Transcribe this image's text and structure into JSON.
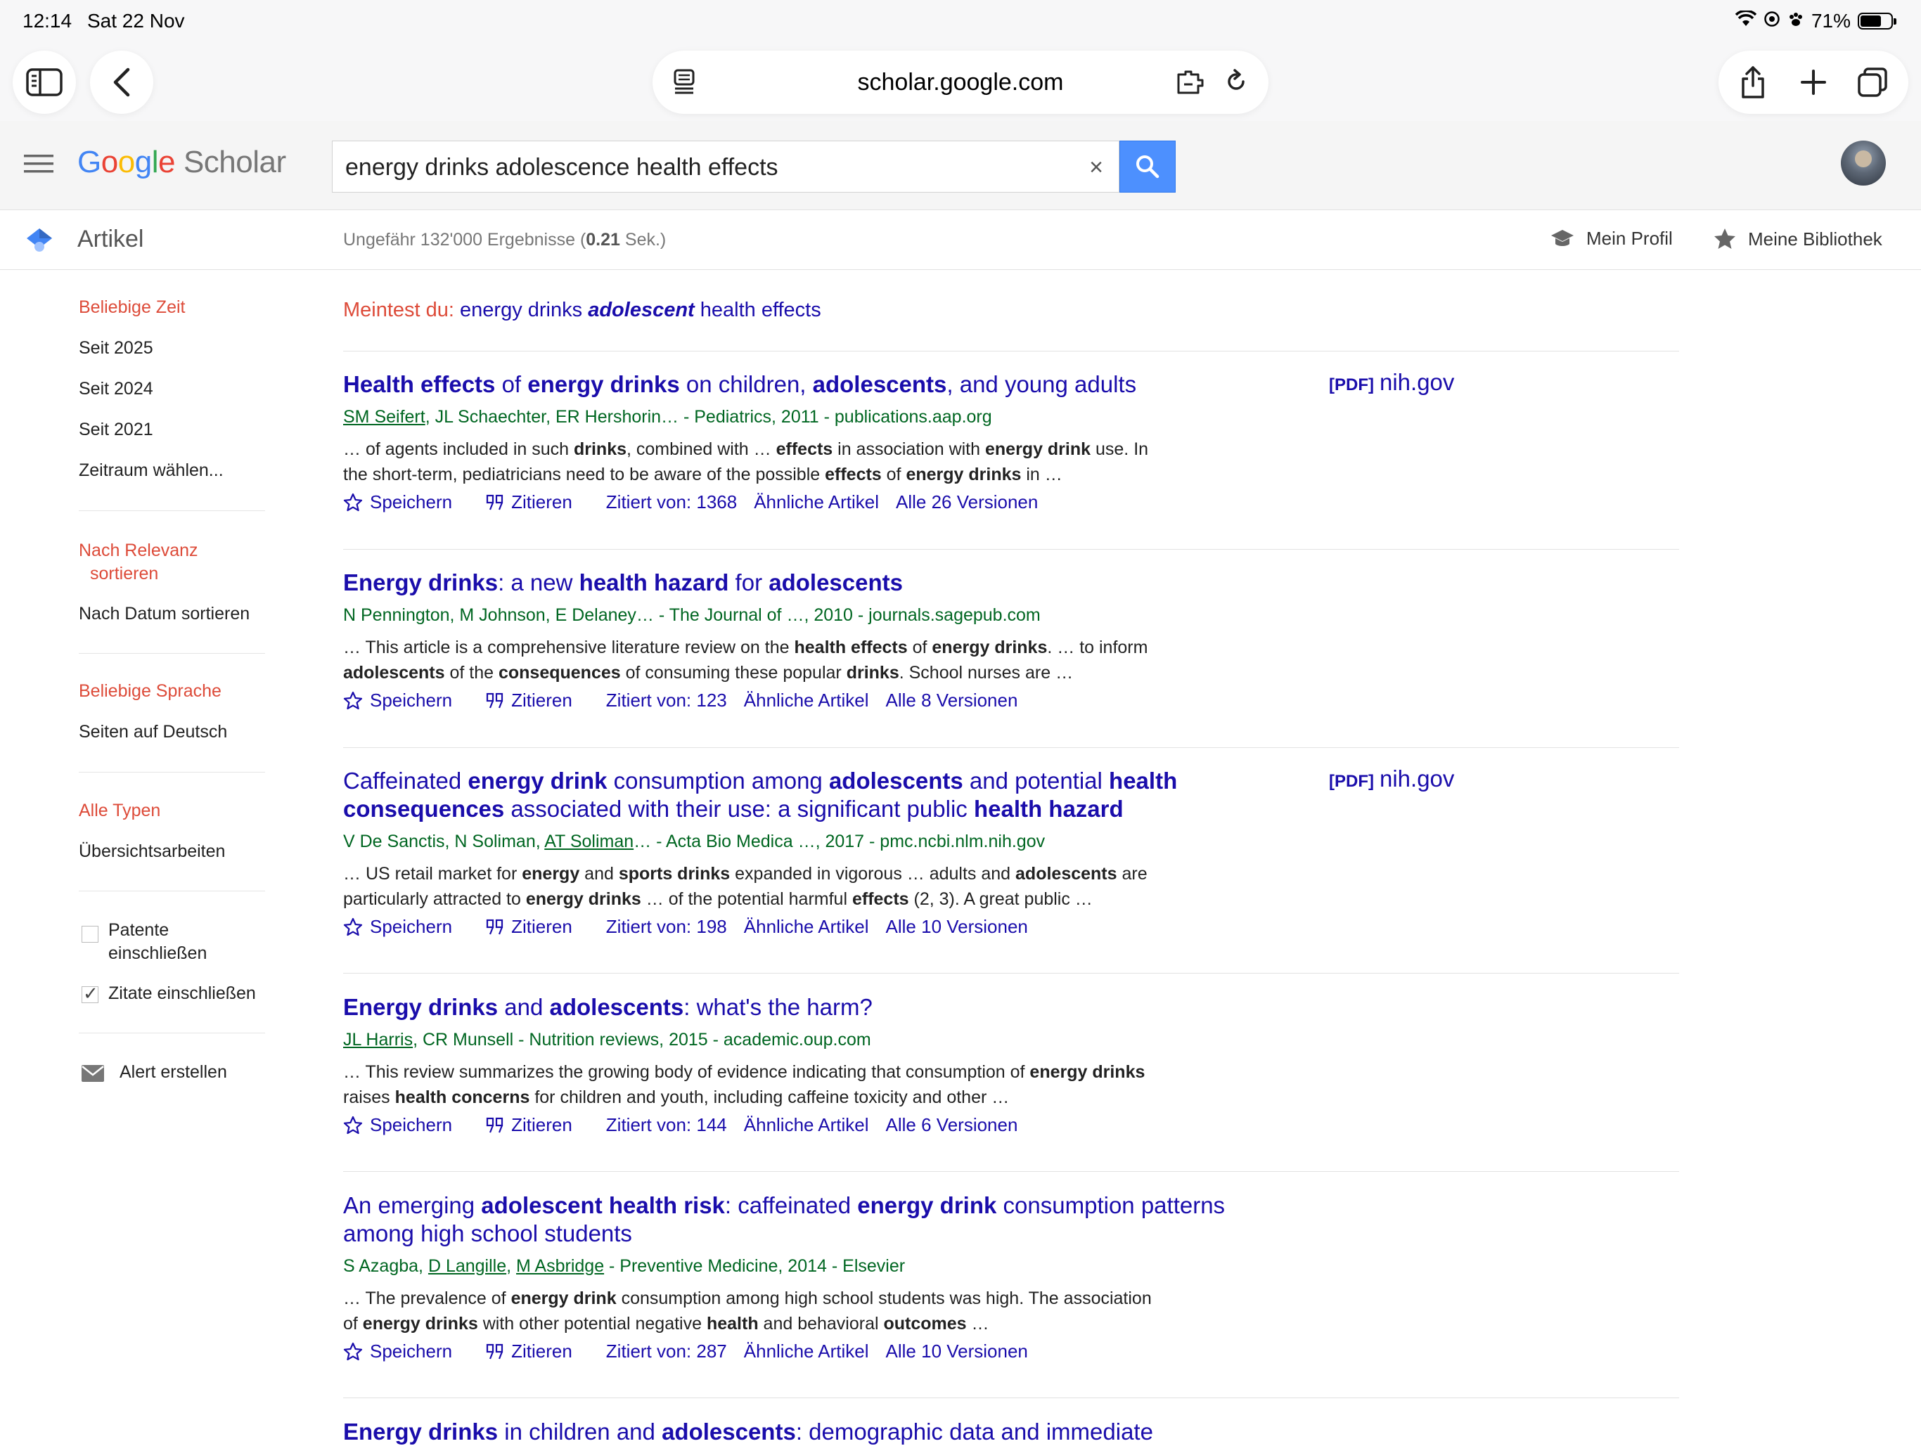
{
  "status": {
    "time": "12:14",
    "date": "Sat 22 Nov",
    "battery_text": "71%",
    "battery_level": 0.71
  },
  "browser": {
    "url": "scholar.google.com"
  },
  "header": {
    "logo_google": [
      "G",
      "o",
      "o",
      "g",
      "l",
      "e"
    ],
    "logo_scholar": "Scholar",
    "search_value": "energy drinks adolescence health effects",
    "clear_symbol": "×"
  },
  "subheader": {
    "section": "Artikel",
    "result_count_prefix": "Ungefähr 132'000 Ergebnisse (",
    "result_time": "0.21",
    "result_count_suffix": " Sek.)",
    "profile": "Mein Profil",
    "library": "Meine Bibliothek"
  },
  "sidebar": {
    "time_any": "Beliebige Zeit",
    "since_2025": "Seit 2025",
    "since_2024": "Seit 2024",
    "since_2021": "Seit 2021",
    "custom_range": "Zeitraum wählen...",
    "sort_relevance_1": "Nach Relevanz",
    "sort_relevance_2": "sortieren",
    "sort_date": "Nach Datum sortieren",
    "lang_any": "Beliebige Sprache",
    "lang_de": "Seiten auf Deutsch",
    "type_all": "Alle Typen",
    "type_review": "Übersichtsarbeiten",
    "patents_1": "Patente",
    "patents_2": "einschließen",
    "citations": "Zitate einschließen",
    "alert": "Alert erstellen"
  },
  "did_you_mean": {
    "label": "Meintest du:",
    "pre": "energy drinks ",
    "bold": "adolescent",
    "post": " health effects"
  },
  "actions": {
    "save": "Speichern",
    "cite": "Zitieren"
  },
  "results": [
    {
      "title_html": "<b>Health effects</b> of <b>energy drinks</b> on children, <b>adolescents</b>, and young adults",
      "authors_html": "<u>SM Seifert</u>, JL Schaechter, ER Hershorin… - Pediatrics, 2011 - publications.aap.org",
      "snippet_html": "… of agents included in such <b>drinks</b>, combined with … <b>effects</b> in association with <b>energy drink</b> use. In the short-term, pediatricians need to be aware of the possible <b>effects</b> of <b>energy drinks</b> in …",
      "cited": "Zitiert von: 1368",
      "related": "Ähnliche Artikel",
      "versions": "Alle 26 Versionen",
      "pdf_tag": "[PDF]",
      "pdf_source": "nih.gov"
    },
    {
      "title_html": "<b>Energy drinks</b>: a new <b>health hazard</b> for <b>adolescents</b>",
      "authors_html": "N Pennington, M Johnson, E Delaney… - The Journal of …, 2010 - journals.sagepub.com",
      "snippet_html": "… This article is a comprehensive literature review on the <b>health effects</b> of <b>energy drinks</b>. … to inform <b>adolescents</b> of the <b>consequences</b> of consuming these popular <b>drinks</b>. School nurses are …",
      "cited": "Zitiert von: 123",
      "related": "Ähnliche Artikel",
      "versions": "Alle 8 Versionen",
      "pdf_tag": "",
      "pdf_source": ""
    },
    {
      "title_html": "Caffeinated <b>energy drink</b> consumption among <b>adolescents</b> and potential <b>health consequences</b> associated with their use: a significant public <b>health hazard</b>",
      "authors_html": "V De Sanctis, N Soliman, <u>AT Soliman</u>… - Acta Bio Medica …, 2017 - pmc.ncbi.nlm.nih.gov",
      "snippet_html": "… US retail market for <b>energy</b> and <b>sports drinks</b> expanded in vigorous … adults and <b>adolescents</b> are particularly attracted to <b>energy drinks</b> … of the potential harmful <b>effects</b> (2, 3). A great public …",
      "cited": "Zitiert von: 198",
      "related": "Ähnliche Artikel",
      "versions": "Alle 10 Versionen",
      "pdf_tag": "[PDF]",
      "pdf_source": "nih.gov"
    },
    {
      "title_html": "<b>Energy drinks</b> and <b>adolescents</b>: what's the harm?",
      "authors_html": "<u>JL Harris</u>, CR Munsell - Nutrition reviews, 2015 - academic.oup.com",
      "snippet_html": "… This review summarizes the growing body of evidence indicating that consumption of <b>energy drinks</b> raises <b>health concerns</b> for children and youth, including caffeine toxicity and other …",
      "cited": "Zitiert von: 144",
      "related": "Ähnliche Artikel",
      "versions": "Alle 6 Versionen",
      "pdf_tag": "",
      "pdf_source": ""
    },
    {
      "title_html": "An emerging <b>adolescent health risk</b>: caffeinated <b>energy drink</b> consumption patterns among high school students",
      "authors_html": "S Azagba, <u>D Langille</u>, <u>M Asbridge</u> - Preventive Medicine, 2014 - Elsevier",
      "snippet_html": "… The prevalence of <b>energy drink</b> consumption among high school students was high. The association of <b>energy drinks</b> with other potential negative <b>health</b> and behavioral <b>outcomes</b> …",
      "cited": "Zitiert von: 287",
      "related": "Ähnliche Artikel",
      "versions": "Alle 10 Versionen",
      "pdf_tag": "",
      "pdf_source": ""
    },
    {
      "title_html": "<b>Energy drinks</b> in children and <b>adolescents</b>: demographic data and immediate"
    }
  ]
}
